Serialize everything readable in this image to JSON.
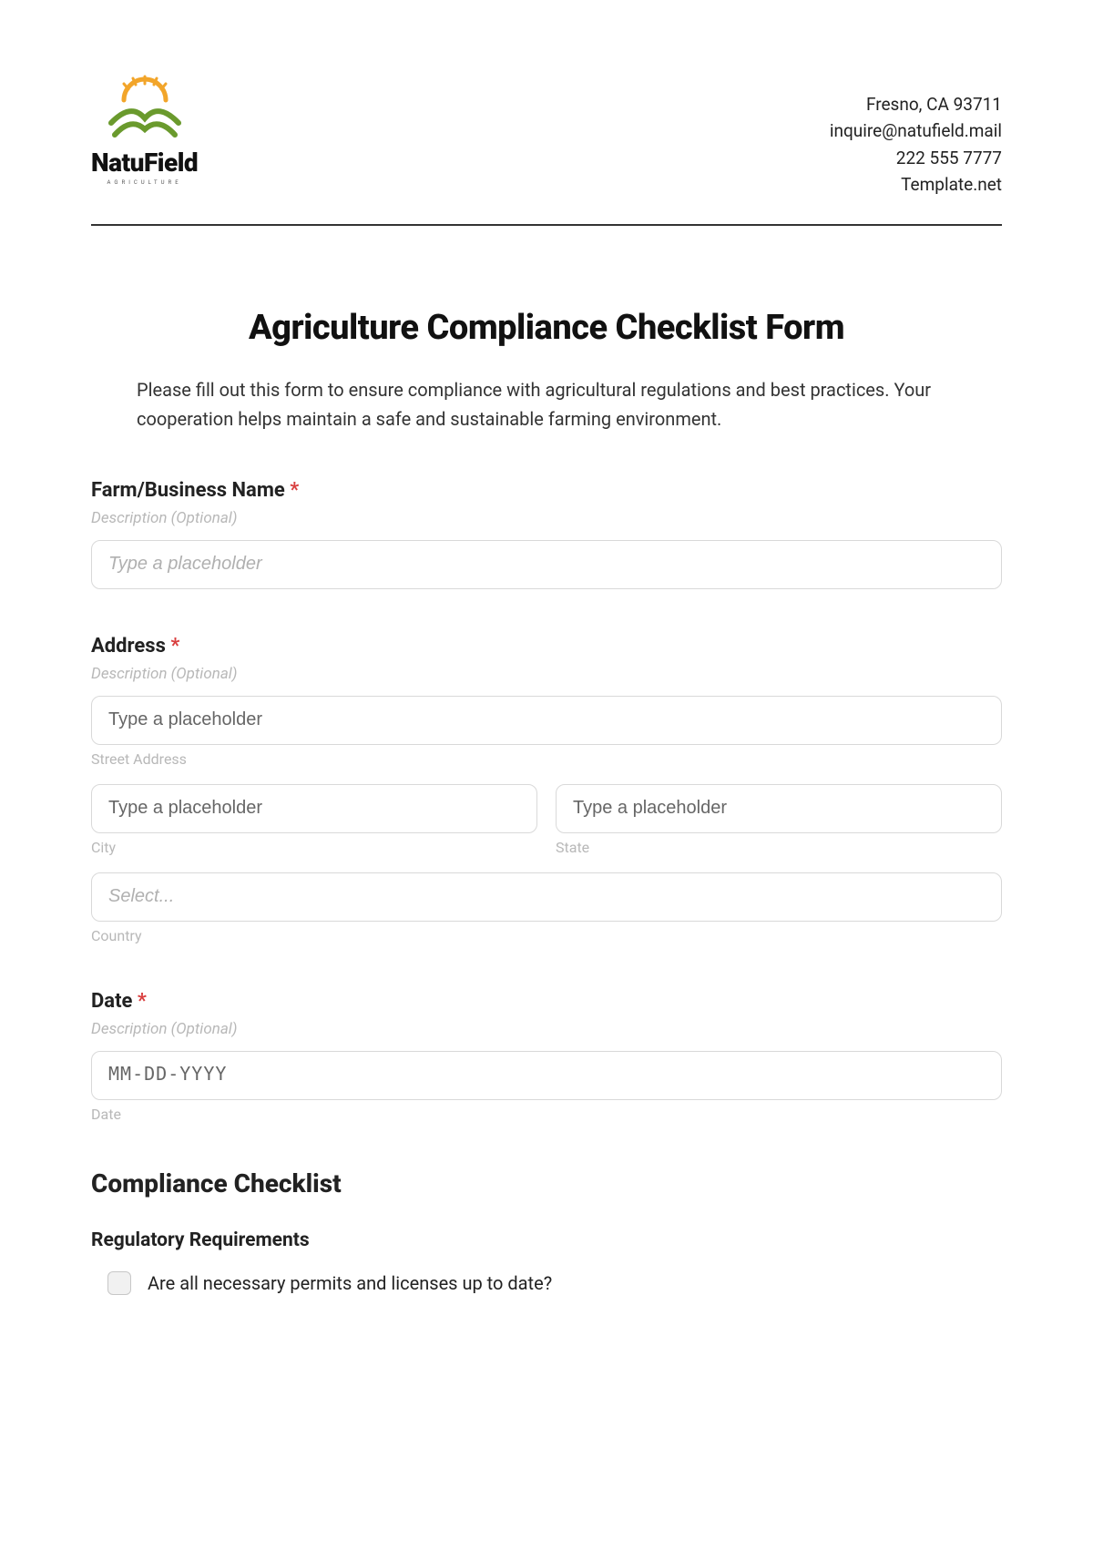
{
  "header": {
    "brand_name": "NatuField",
    "brand_tagline": "AGRICULTURE",
    "contact": {
      "address": "Fresno, CA 93711",
      "email": "inquire@natufield.mail",
      "phone": "222 555 7777",
      "site": "Template.net"
    }
  },
  "form": {
    "title": "Agriculture Compliance Checklist Form",
    "description": "Please fill out this form to ensure compliance with agricultural regulations and best practices. Your cooperation helps maintain a safe and sustainable farming environment."
  },
  "fields": {
    "farm_name": {
      "label": "Farm/Business Name ",
      "required": "*",
      "desc": "Description (Optional)",
      "placeholder": "Type a placeholder"
    },
    "address": {
      "label": "Address ",
      "required": "*",
      "desc": "Description (Optional)",
      "street_placeholder": "Type a placeholder",
      "street_sub": "Street Address",
      "city_placeholder": "Type a placeholder",
      "city_sub": "City",
      "state_placeholder": "Type a placeholder",
      "state_sub": "State",
      "country_placeholder": "Select...",
      "country_sub": "Country"
    },
    "date": {
      "label": "Date ",
      "required": "*",
      "desc": "Description (Optional)",
      "placeholder": "MM-DD-YYYY",
      "sub": "Date"
    }
  },
  "checklist": {
    "section_title": "Compliance Checklist",
    "groups": [
      {
        "title": "Regulatory Requirements",
        "items": [
          "Are all necessary permits and licenses up to date?"
        ]
      }
    ]
  }
}
